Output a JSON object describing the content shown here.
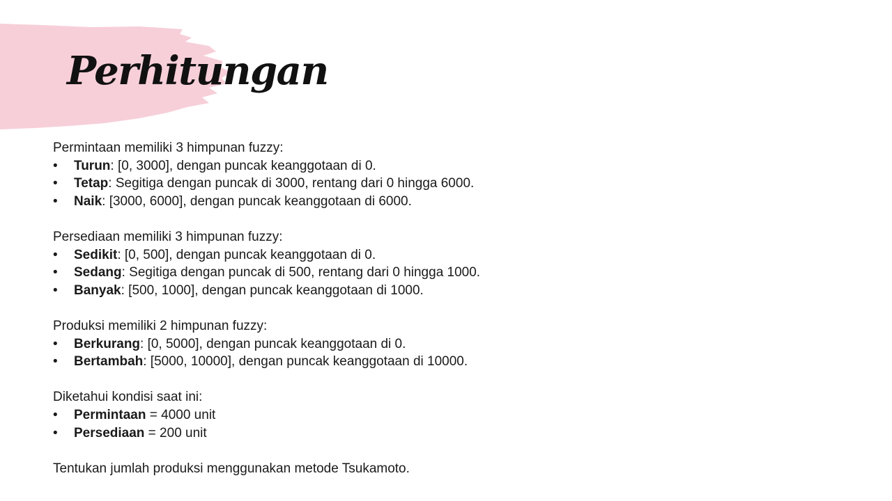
{
  "title": "Perhitungan",
  "colors": {
    "brush": "#f7cfd9",
    "text": "#1a1a1a",
    "title": "#111111"
  },
  "bullet_glyph": "•",
  "sections": [
    {
      "intro": "Permintaan memiliki 3 himpunan fuzzy:",
      "items": [
        {
          "term": "Turun",
          "desc": ": [0, 3000], dengan puncak keanggotaan di 0."
        },
        {
          "term": "Tetap",
          "desc": ": Segitiga dengan puncak di 3000, rentang dari 0 hingga 6000."
        },
        {
          "term": "Naik",
          "desc": ": [3000, 6000], dengan puncak keanggotaan di 6000."
        }
      ]
    },
    {
      "intro": "Persediaan memiliki 3 himpunan fuzzy:",
      "items": [
        {
          "term": "Sedikit",
          "desc": ": [0, 500], dengan puncak keanggotaan di 0."
        },
        {
          "term": "Sedang",
          "desc": ": Segitiga dengan puncak di 500, rentang dari 0 hingga 1000."
        },
        {
          "term": "Banyak",
          "desc": ": [500, 1000], dengan puncak keanggotaan di 1000."
        }
      ]
    },
    {
      "intro": "Produksi memiliki 2 himpunan fuzzy:",
      "items": [
        {
          "term": "Berkurang",
          "desc": ": [0, 5000], dengan puncak keanggotaan di 0."
        },
        {
          "term": "Bertambah",
          "desc": ": [5000, 10000], dengan puncak keanggotaan di 10000."
        }
      ]
    },
    {
      "intro": "Diketahui kondisi saat ini:",
      "items": [
        {
          "term": "Permintaan",
          "desc": " = 4000 unit"
        },
        {
          "term": "Persediaan",
          "desc": " = 200 unit"
        }
      ]
    }
  ],
  "conclusion": "Tentukan jumlah produksi menggunakan metode Tsukamoto."
}
